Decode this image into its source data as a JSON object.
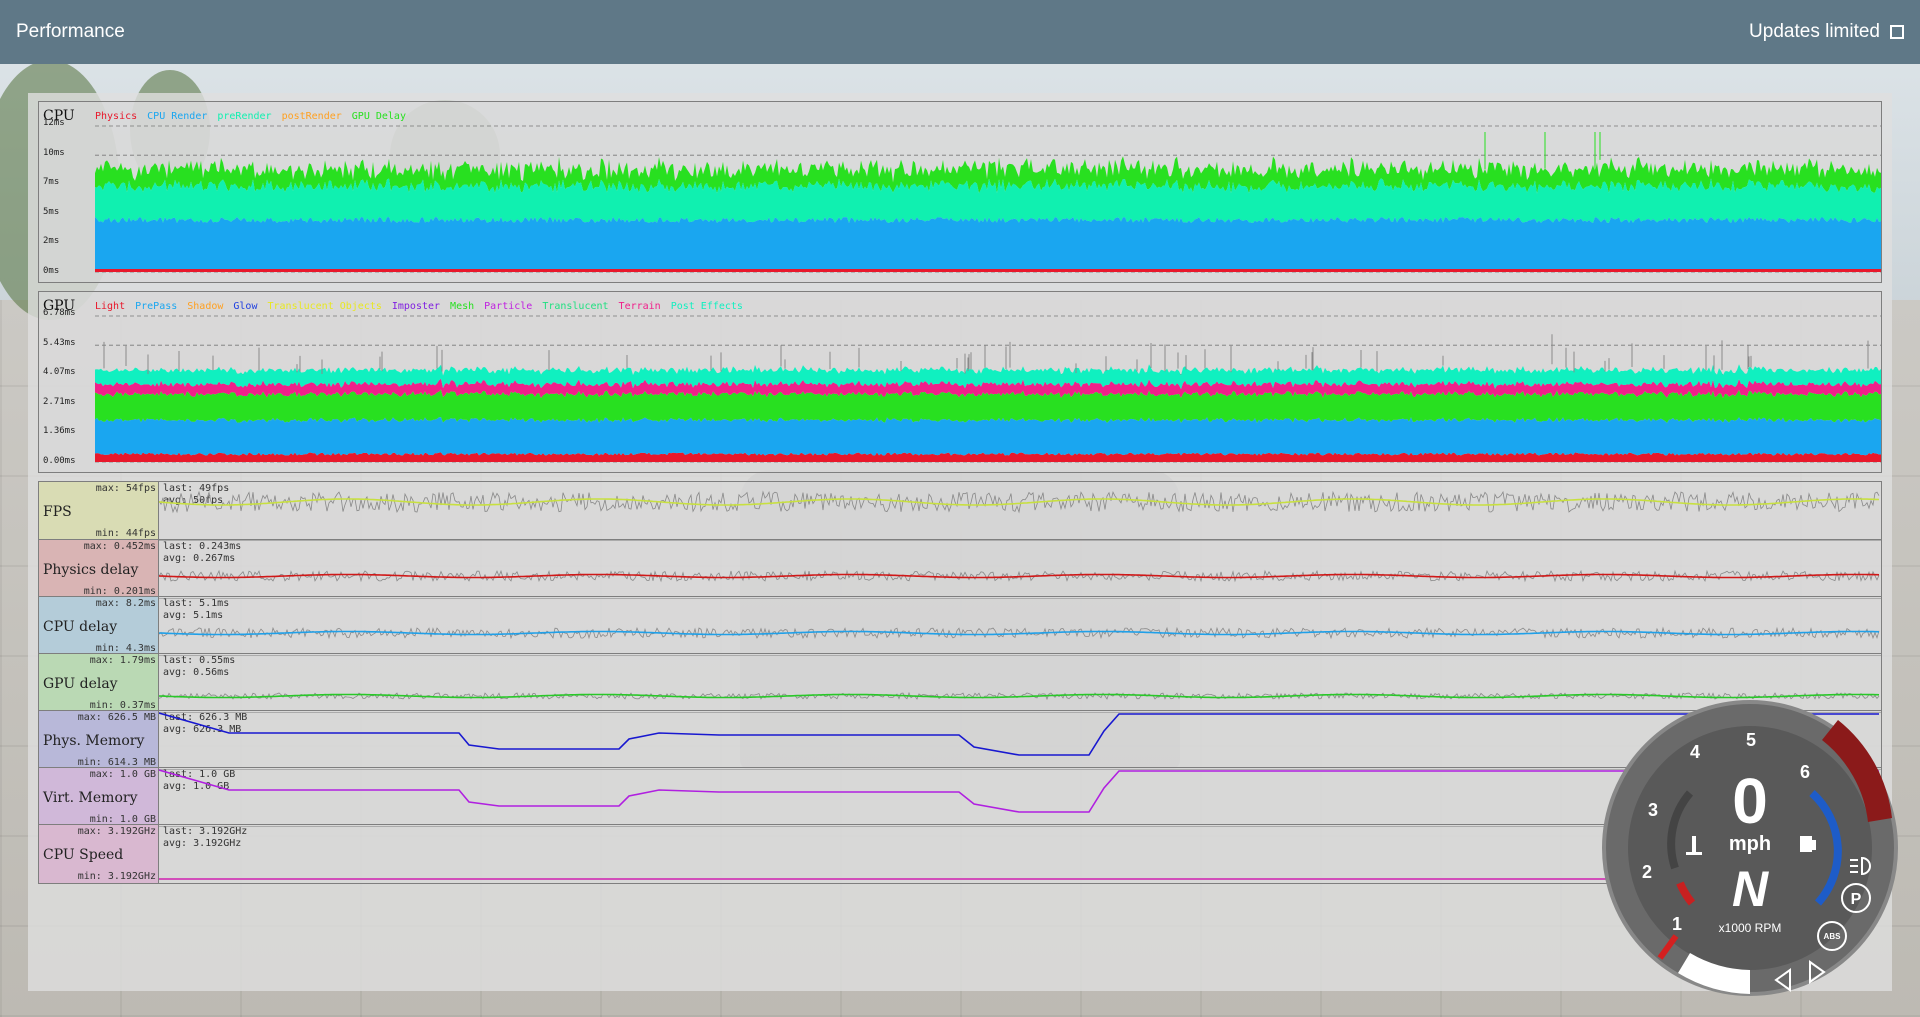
{
  "header": {
    "title": "Performance",
    "updates_label": "Updates limited"
  },
  "cpu_graph": {
    "title": "CPU",
    "legend": [
      {
        "label": "Physics",
        "color": "#e8182b"
      },
      {
        "label": "CPU Render",
        "color": "#1aa6f0"
      },
      {
        "label": "preRender",
        "color": "#10f0b0"
      },
      {
        "label": "postRender",
        "color": "#ffa020"
      },
      {
        "label": "GPU Delay",
        "color": "#28e020"
      }
    ],
    "yticks": [
      "12ms",
      "10ms",
      "7ms",
      "5ms",
      "2ms",
      "0ms"
    ]
  },
  "gpu_graph": {
    "title": "GPU",
    "legend": [
      {
        "label": "Light",
        "color": "#e8182b"
      },
      {
        "label": "PrePass",
        "color": "#1aa6f0"
      },
      {
        "label": "Shadow",
        "color": "#ffa020"
      },
      {
        "label": "Glow",
        "color": "#2040e0"
      },
      {
        "label": "Translucent Objects",
        "color": "#e8e820"
      },
      {
        "label": "Imposter",
        "color": "#8020e0"
      },
      {
        "label": "Mesh",
        "color": "#28e020"
      },
      {
        "label": "Particle",
        "color": "#c020e0"
      },
      {
        "label": "Translucent",
        "color": "#20e080"
      },
      {
        "label": "Terrain",
        "color": "#f0208a"
      },
      {
        "label": "Post Effects",
        "color": "#10f0c0"
      }
    ],
    "yticks": [
      "6.78ms",
      "5.43ms",
      "4.07ms",
      "2.71ms",
      "1.36ms",
      "0.00ms"
    ]
  },
  "metrics": [
    {
      "name": "FPS",
      "max": "max: 54fps",
      "min": "min: 44fps",
      "last": "last: 49fps",
      "avg": "avg: 50fps",
      "color": "#c8e040",
      "bg": "#d9dcb4"
    },
    {
      "name": "Physics delay",
      "max": "max: 0.452ms",
      "min": "min: 0.201ms",
      "last": "last: 0.243ms",
      "avg": "avg: 0.267ms",
      "color": "#d01818",
      "bg": "#d9b4b4"
    },
    {
      "name": "CPU delay",
      "max": "max: 8.2ms",
      "min": "min: 4.3ms",
      "last": "last: 5.1ms",
      "avg": "avg: 5.1ms",
      "color": "#20a0e8",
      "bg": "#b4ccd9"
    },
    {
      "name": "GPU delay",
      "max": "max: 1.79ms",
      "min": "min: 0.37ms",
      "last": "last: 0.55ms",
      "avg": "avg: 0.56ms",
      "color": "#28c828",
      "bg": "#bad9b4"
    },
    {
      "name": "Phys. Memory",
      "max": "max: 626.5 MB",
      "min": "min: 614.3 MB",
      "last": "last: 626.3 MB",
      "avg": "avg: 626.3 MB",
      "color": "#1818d0",
      "bg": "#b8b8d9"
    },
    {
      "name": "Virt. Memory",
      "max": "max: 1.0 GB",
      "min": "min: 1.0 GB",
      "last": "last: 1.0 GB",
      "avg": "avg: 1.0 GB",
      "color": "#b020e0",
      "bg": "#d0b8d9"
    },
    {
      "name": "CPU Speed",
      "max": "max: 3.192GHz",
      "min": "min: 3.192GHz",
      "last": "last: 3.192GHz",
      "avg": "avg: 3.192GHz",
      "color": "#d020b0",
      "bg": "#d9b8d0"
    }
  ],
  "dashboard": {
    "speed": "0",
    "speed_unit": "mph",
    "gear": "N",
    "rpm_label": "x1000 RPM",
    "ticks": [
      "1",
      "2",
      "3",
      "4",
      "5",
      "6"
    ],
    "badges": {
      "park": "P",
      "abs": "ABS"
    }
  }
}
